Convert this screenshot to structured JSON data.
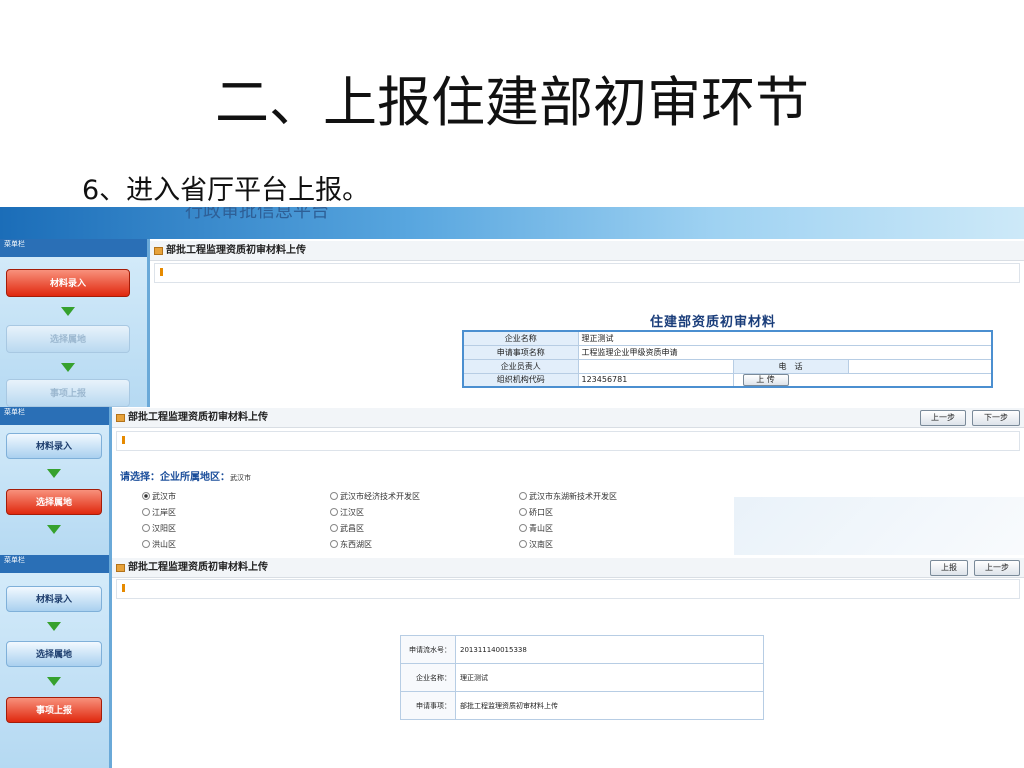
{
  "slide": {
    "title": "二、上报住建部初审环节",
    "subtitle": "6、进入省厅平台上报。"
  },
  "screen1": {
    "banner_text": "行政审批信息平台",
    "sidebar_header": "菜单栏",
    "steps": [
      "材料录入",
      "选择属地",
      "事项上报"
    ],
    "page_title": "部批工程监理资质初审材料上传",
    "table_title": "住建部资质初审材料",
    "rows": {
      "company_label": "企业名称",
      "company_value": "理正测试",
      "matter_label": "申请事项名称",
      "matter_value": "工程监理企业甲级资质申请",
      "staff_label": "企业员责人",
      "staff_value": "",
      "phone_label": "电　话",
      "phone_value": "",
      "org_label": "组织机构代码",
      "org_value": "123456781",
      "upload_button": "上 传"
    }
  },
  "screen2": {
    "sidebar_header": "菜单栏",
    "steps": [
      "材料录入",
      "选择属地"
    ],
    "page_title": "部批工程监理资质初审材料上传",
    "prev_button": "上一步",
    "next_button": "下一步",
    "select_label": "请选择：企业所属地区：",
    "selected_region": "武汉市",
    "regions": [
      "武汉市",
      "武汉市经济技术开发区",
      "武汉市东湖新技术开发区",
      "江岸区",
      "江汉区",
      "硚口区",
      "汉阳区",
      "武昌区",
      "青山区",
      "洪山区",
      "东西湖区",
      "汉南区"
    ]
  },
  "screen3": {
    "sidebar_header": "菜单栏",
    "steps": [
      "材料录入",
      "选择属地",
      "事项上报"
    ],
    "page_title": "部批工程监理资质初审材料上传",
    "report_button": "上报",
    "prev_button": "上一步",
    "summary": {
      "serial_label": "申请流水号：",
      "serial_value": "201311140015338",
      "company_label": "企业名称：",
      "company_value": "理正测试",
      "matter_label": "申请事项：",
      "matter_value": "部批工程监理资质初审材料上传"
    }
  }
}
